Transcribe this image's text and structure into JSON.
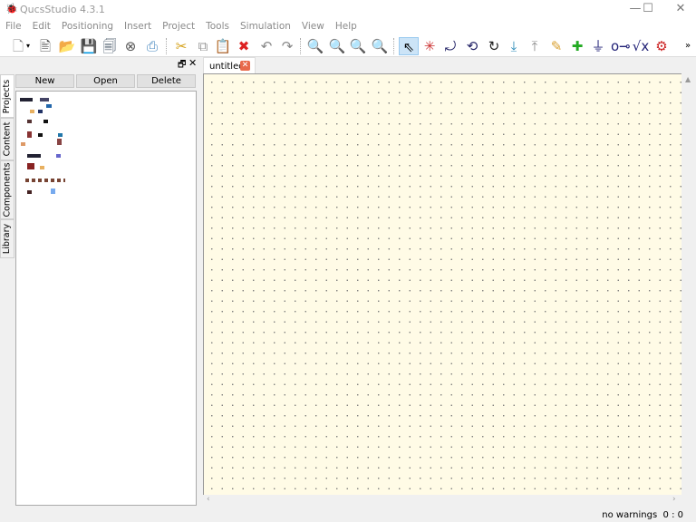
{
  "window": {
    "title": "QucsStudio 4.3.1"
  },
  "menu": [
    "File",
    "Edit",
    "Positioning",
    "Insert",
    "Project",
    "Tools",
    "Simulation",
    "View",
    "Help"
  ],
  "toolbar": [
    "new-icon",
    "dropdown-icon",
    "new-text-icon",
    "open-icon",
    "save-icon",
    "save-all-icon",
    "close-icon",
    "print-icon",
    "cut-icon",
    "copy-icon",
    "paste-icon",
    "delete-icon",
    "undo-icon",
    "redo-icon",
    "zoom-fit-icon",
    "zoom-1-icon",
    "zoom-in-icon",
    "zoom-out-icon",
    "select-icon",
    "mirror-icon",
    "mirror-x-icon",
    "rotate-y-icon",
    "rotate-icon",
    "go-into-icon",
    "pop-out-icon",
    "wire-icon",
    "label-icon",
    "ground-icon",
    "port-icon",
    "equation-icon",
    "simulate-icon",
    "more-icon"
  ],
  "panel": {
    "buttons": [
      "New",
      "Open",
      "Delete"
    ],
    "tabs": [
      "Projects",
      "Content",
      "Components",
      "Library"
    ]
  },
  "document_tab": {
    "label": "untitled"
  },
  "status": {
    "text": "no warnings",
    "coords": "0 : 0"
  }
}
